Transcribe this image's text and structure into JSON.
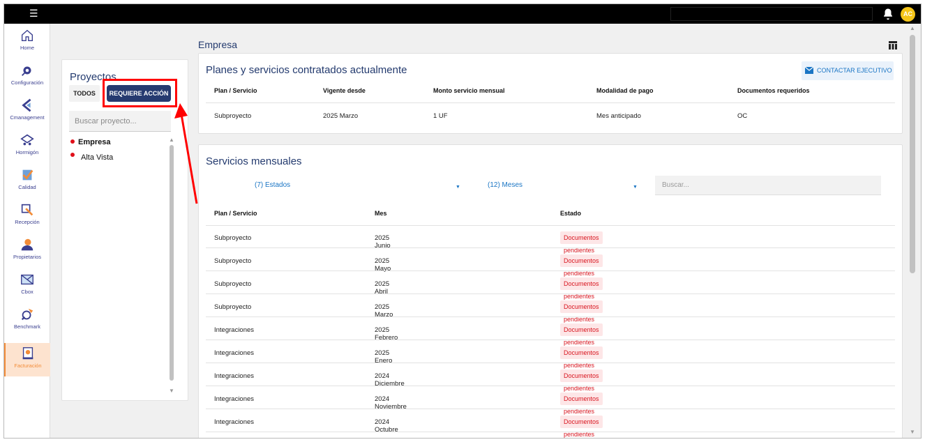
{
  "topbar": {
    "avatar_initials": "AC"
  },
  "sidebar": {
    "items": [
      {
        "label": "Home",
        "icon": "home-icon"
      },
      {
        "label": "Configuración",
        "icon": "gear-icon"
      },
      {
        "label": "Cmanagement",
        "icon": "cmanagement-icon"
      },
      {
        "label": "Hormigón",
        "icon": "hormigon-icon"
      },
      {
        "label": "Calidad",
        "icon": "calidad-icon"
      },
      {
        "label": "Recepción",
        "icon": "recepcion-icon"
      },
      {
        "label": "Propietarios",
        "icon": "propietarios-icon"
      },
      {
        "label": "Cbox",
        "icon": "cbox-icon"
      },
      {
        "label": "Benchmark",
        "icon": "benchmark-icon"
      },
      {
        "label": "Facturación",
        "icon": "facturacion-icon",
        "active": true
      }
    ]
  },
  "projects": {
    "title": "Proyectos",
    "btn_all": "TODOS",
    "btn_action": "REQUIERE ACCIÓN",
    "search_placeholder": "Buscar proyecto...",
    "items": [
      {
        "label": "Empresa",
        "bold": true
      },
      {
        "label": "Alta Vista",
        "bold": false
      }
    ]
  },
  "main": {
    "title": "Empresa",
    "plans": {
      "title": "Planes y servicios contratados actualmente",
      "contact_label": "CONTACTAR EJECUTIVO",
      "headers": [
        "Plan / Servicio",
        "Vigente desde",
        "Monto servicio mensual",
        "Modalidad de pago",
        "Documentos requeridos"
      ],
      "rows": [
        [
          "Subproyecto",
          "2025 Marzo",
          "1 UF",
          "Mes anticipado",
          "OC"
        ]
      ]
    },
    "monthly": {
      "title": "Servicios mensuales",
      "filter_states": "(7) Estados",
      "filter_months": "(12) Meses",
      "search_placeholder": "Buscar...",
      "headers": [
        "Plan / Servicio",
        "Mes",
        "Estado"
      ],
      "rows": [
        [
          "Subproyecto",
          "2025 Junio",
          "Documentos pendientes"
        ],
        [
          "Subproyecto",
          "2025 Mayo",
          "Documentos pendientes"
        ],
        [
          "Subproyecto",
          "2025 Abril",
          "Documentos pendientes"
        ],
        [
          "Subproyecto",
          "2025 Marzo",
          "Documentos pendientes"
        ],
        [
          "Integraciones",
          "2025 Febrero",
          "Documentos pendientes"
        ],
        [
          "Integraciones",
          "2025 Enero",
          "Documentos pendientes"
        ],
        [
          "Integraciones",
          "2024 Diciembre",
          "Documentos pendientes"
        ],
        [
          "Integraciones",
          "2024 Noviembre",
          "Documentos pendientes"
        ],
        [
          "Integraciones",
          "2024 Octubre",
          "Documentos pendientes"
        ]
      ]
    }
  },
  "colors": {
    "accent": "#263a70",
    "highlight": "#ff0000",
    "status_red": "#d8141e",
    "active_orange": "#f28c38"
  }
}
